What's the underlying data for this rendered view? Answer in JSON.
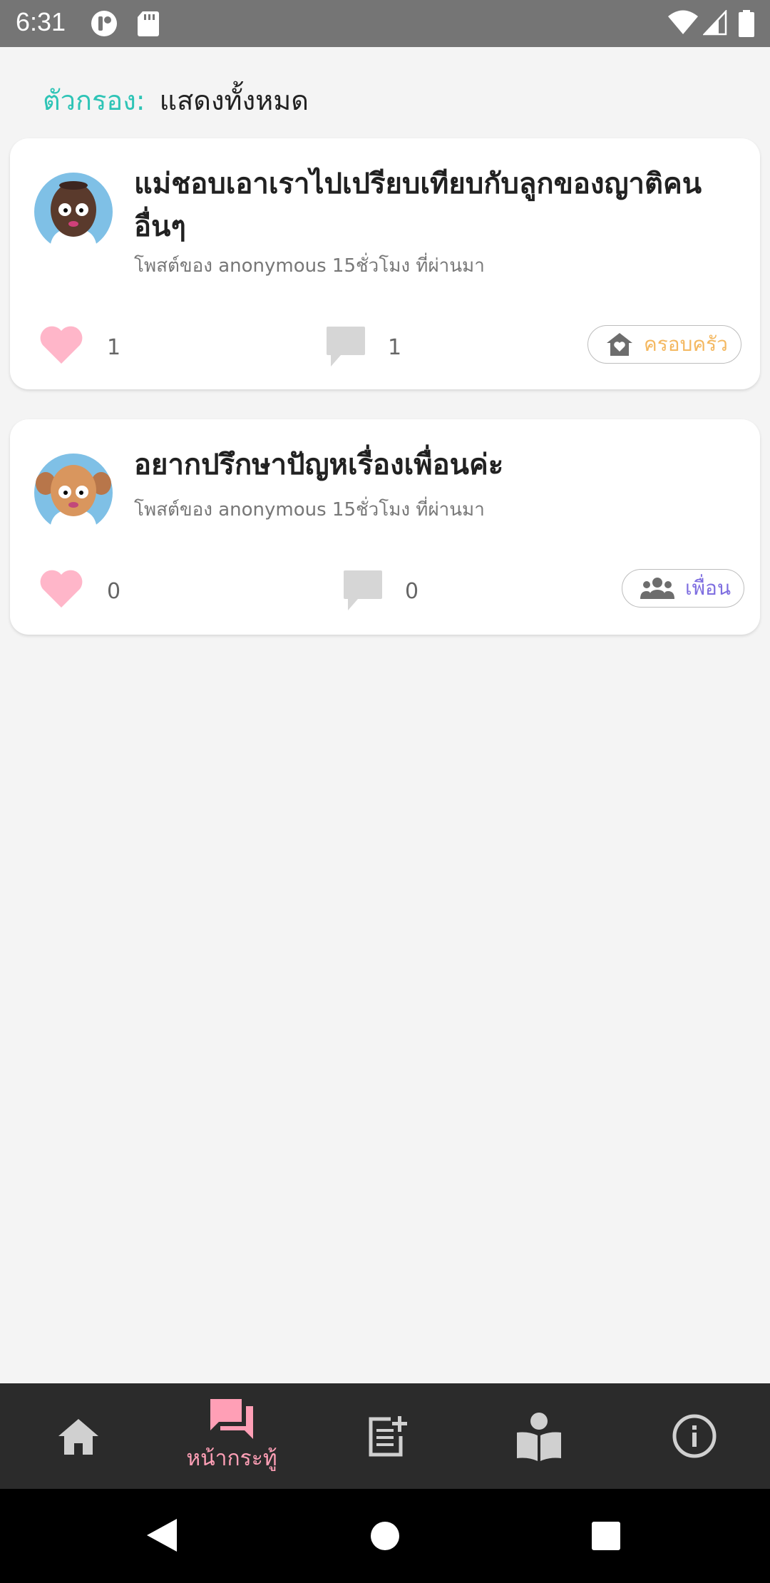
{
  "status_bar": {
    "time": "6:31"
  },
  "filter": {
    "label": "ตัวกรอง:",
    "value": "แสดงทั้งหมด"
  },
  "posts": [
    {
      "title": "แม่ชอบเอาเราไปเปรียบเทียบกับลูกของญาติคนอื่นๆ",
      "meta": "โพสต์ของ anonymous 15ชั่วโมง ที่ผ่านมา",
      "likes": "1",
      "comments": "1",
      "tag": "ครอบครัว",
      "tag_icon": "house-heart-icon",
      "tag_color": "#f4b860"
    },
    {
      "title": "อยากปรึกษาปัญหเรื่องเพื่อนค่ะ",
      "meta": "โพสต์ของ anonymous 15ชั่วโมง ที่ผ่านมา",
      "likes": "0",
      "comments": "0",
      "tag": "เพื่อน",
      "tag_icon": "people-icon",
      "tag_color": "#7e6ee0"
    }
  ],
  "bottom_nav": {
    "items": [
      {
        "icon": "home-icon"
      },
      {
        "icon": "forum-icon",
        "label": "หน้ากระทู้",
        "active": true
      },
      {
        "icon": "post-add-icon"
      },
      {
        "icon": "book-reader-icon"
      },
      {
        "icon": "info-icon"
      }
    ]
  },
  "colors": {
    "accent": "#2ec4b6",
    "like": "#ffb6c9",
    "active_nav": "#ff9fb6",
    "nav_bg": "#2b2b2b"
  }
}
